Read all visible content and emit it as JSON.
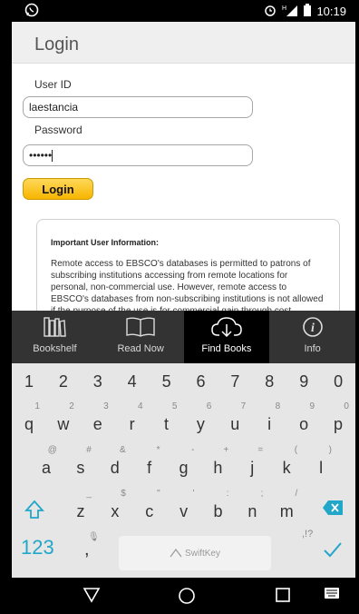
{
  "status_bar": {
    "time": "10:19"
  },
  "login": {
    "title": "Login",
    "user_id_label": "User ID",
    "user_id_value": "laestancia",
    "password_label": "Password",
    "password_value": "••••••",
    "login_button": "Login"
  },
  "info": {
    "title": "Important User Information:",
    "text": "Remote access to EBSCO's databases is permitted to patrons of subscribing institutions accessing from remote locations for personal, non-commercial use. However, remote access to EBSCO's databases from non-subscribing institutions is not allowed if the purpose of the use is for commercial gain through cost reduction or"
  },
  "tabs": [
    {
      "label": "Bookshelf",
      "icon": "bookshelf-icon"
    },
    {
      "label": "Read Now",
      "icon": "open-book-icon"
    },
    {
      "label": "Find Books",
      "icon": "download-cloud-icon",
      "active": true
    },
    {
      "label": "Info",
      "icon": "info-icon"
    }
  ],
  "keyboard": {
    "numbers": [
      "1",
      "2",
      "3",
      "4",
      "5",
      "6",
      "7",
      "8",
      "9",
      "0"
    ],
    "row1": [
      {
        "k": "q",
        "a": "1"
      },
      {
        "k": "w",
        "a": "2"
      },
      {
        "k": "e",
        "a": "3"
      },
      {
        "k": "r",
        "a": "4"
      },
      {
        "k": "t",
        "a": "5"
      },
      {
        "k": "y",
        "a": "6"
      },
      {
        "k": "u",
        "a": "7"
      },
      {
        "k": "i",
        "a": "8"
      },
      {
        "k": "o",
        "a": "9"
      },
      {
        "k": "p",
        "a": "0"
      }
    ],
    "row2": [
      {
        "k": "a",
        "a": "@"
      },
      {
        "k": "s",
        "a": "#"
      },
      {
        "k": "d",
        "a": "&"
      },
      {
        "k": "f",
        "a": "*"
      },
      {
        "k": "g",
        "a": "-"
      },
      {
        "k": "h",
        "a": "+"
      },
      {
        "k": "j",
        "a": "="
      },
      {
        "k": "k",
        "a": "("
      },
      {
        "k": "l",
        "a": ")"
      }
    ],
    "row3": [
      {
        "k": "z",
        "a": "_"
      },
      {
        "k": "x",
        "a": "$"
      },
      {
        "k": "c",
        "a": "\""
      },
      {
        "k": "v",
        "a": "'"
      },
      {
        "k": "b",
        "a": ":"
      },
      {
        "k": "n",
        "a": ";"
      },
      {
        "k": "m",
        "a": "/"
      }
    ],
    "symbols_key": "123",
    "comma_key": ",",
    "comma_alt": "🎙",
    "space_brand": "SwiftKey",
    "punct_hint": ",!?",
    "accent_color": "#22a7c9"
  }
}
